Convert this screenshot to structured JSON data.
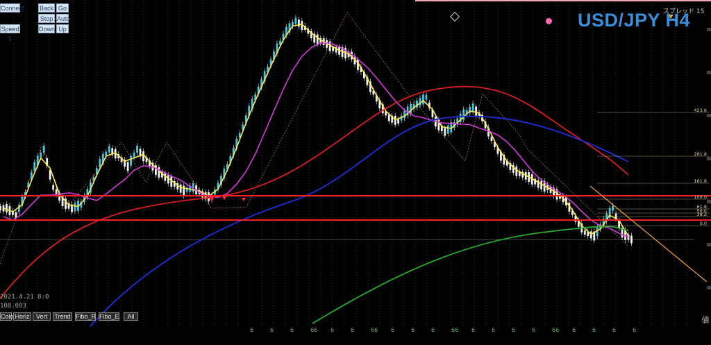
{
  "title": "USD/JPY H4",
  "spread_label": "スプレッド",
  "spread_value": "15",
  "colors": {
    "background": "#000000",
    "candle_up": "#41c7e0",
    "candle_down": "#f2f2f2",
    "ma_fast": "#ffe84a",
    "ma_mid": "#d23ad8",
    "ma_slow": "#d81e1e",
    "ma_long": "#1e2fd8",
    "ma_very_long": "#27a82c",
    "support_lines": "#ff1f1f",
    "trend_line": "#e59a3a",
    "fibo": "#cfc89a",
    "title": "#3a8fd8"
  },
  "control_buttons": [
    "Connect",
    "Back",
    "Go",
    "Stop",
    "Auto",
    "Speed 1",
    "Down",
    "Up"
  ],
  "bottom_toolbar": [
    "Color",
    "Horiz",
    "Vert",
    "Trend",
    "Fibo_R",
    "Fibo_E",
    "All"
  ],
  "info_lines": [
    "2021.4.21 8:0",
    "108.003"
  ],
  "icons": [
    "pink-dot-marker",
    "diamond-marker",
    "spread-arrow-icon"
  ],
  "chart_data": {
    "type": "candlestick",
    "title": "USD/JPY H4",
    "fibo_levels": [
      "423.6",
      "261.8",
      "161.8",
      "100.0",
      "61.8",
      "50.0",
      "38.2",
      "0.0"
    ],
    "x_tick_labels": [
      "6",
      "6",
      "6",
      "66",
      "6",
      "6",
      "66",
      "6",
      "6",
      "6",
      "66",
      "6",
      "6",
      "6",
      "6",
      "66",
      "6",
      "6",
      "6",
      "6"
    ],
    "x_tick_label_note": "tick marks along bottom axis",
    "horizontal_lines": 2,
    "moving_averages": [
      "yellow fast MA",
      "magenta MA",
      "red MA",
      "blue MA",
      "green MA"
    ],
    "price_path": [
      300,
      310,
      280,
      240,
      215,
      270,
      290,
      300,
      295,
      270,
      235,
      215,
      225,
      240,
      215,
      230,
      245,
      255,
      265,
      275,
      270,
      280,
      285,
      260,
      230,
      195,
      160,
      130,
      100,
      70,
      45,
      30,
      40,
      55,
      60,
      70,
      75,
      80,
      100,
      125,
      150,
      170,
      175,
      160,
      150,
      140,
      175,
      190,
      180,
      165,
      155,
      170,
      200,
      225,
      240,
      250,
      255,
      265,
      270,
      280,
      290,
      315,
      335,
      340,
      320,
      300,
      335,
      345
    ]
  }
}
